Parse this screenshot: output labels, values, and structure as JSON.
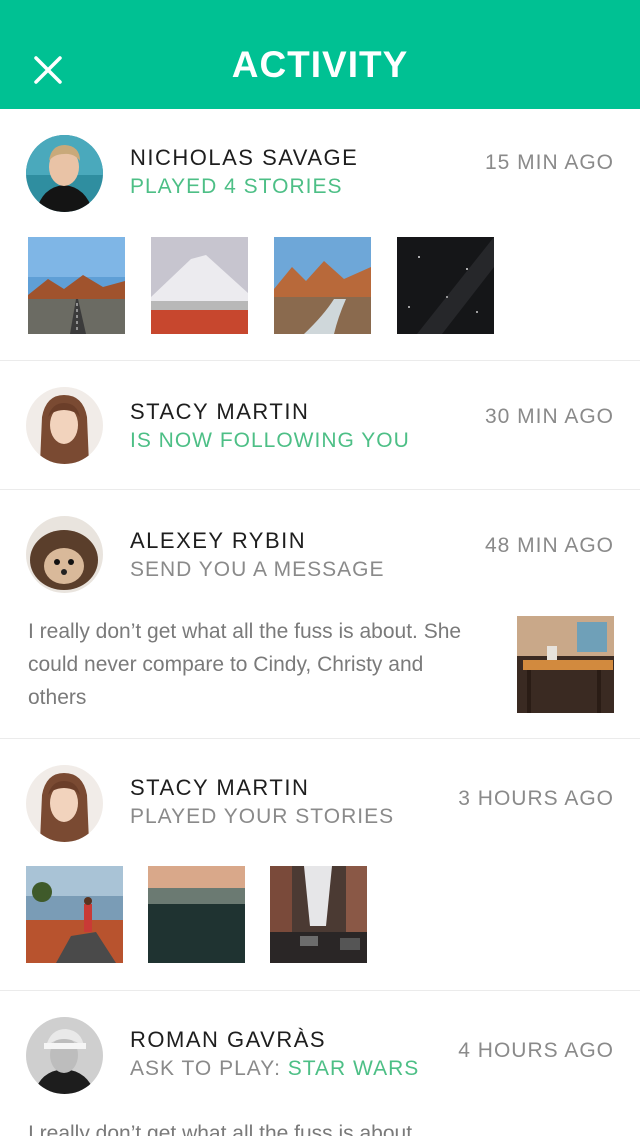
{
  "header": {
    "title": "ACTIVITY",
    "close_icon": "close-icon",
    "background": "#00c193"
  },
  "colors": {
    "accent_green": "#4dbf86",
    "muted_text": "#8a8a8a",
    "divider": "#ebebeb"
  },
  "feed": [
    {
      "name": "NICHOLAS SAVAGE",
      "action": "PLAYED 4 STORIES",
      "time": "15 MIN AGO",
      "thumbnails": [
        "desert-road-photo",
        "snowy-mountain-photo",
        "mountain-river-photo",
        "night-sky-photo"
      ]
    },
    {
      "name": "STACY MARTIN",
      "action": "IS NOW FOLLOWING YOU",
      "time": "30 MIN AGO"
    },
    {
      "name": "ALEXEY RYBIN",
      "action": "SEND YOU A MESSAGE",
      "time": "48 MIN AGO",
      "message": "I really don’t get what all the fuss is about. She could never compare to Cindy, Christy and others",
      "attachment": "restaurant-table-photo"
    },
    {
      "name": "STACY MARTIN",
      "action": "PLAYED YOUR STORIES",
      "time": "3 HOURS AGO",
      "thumbnails": [
        "lake-shore-photo",
        "foggy-valley-photo",
        "rainy-street-photo"
      ]
    },
    {
      "name": "ROMAN GAVRÀS",
      "action_prefix": "ASK TO PLAY: ",
      "action_link": "STAR WARS",
      "time": "4 HOURS AGO",
      "message": "I really don’t get what all the fuss is about."
    }
  ]
}
